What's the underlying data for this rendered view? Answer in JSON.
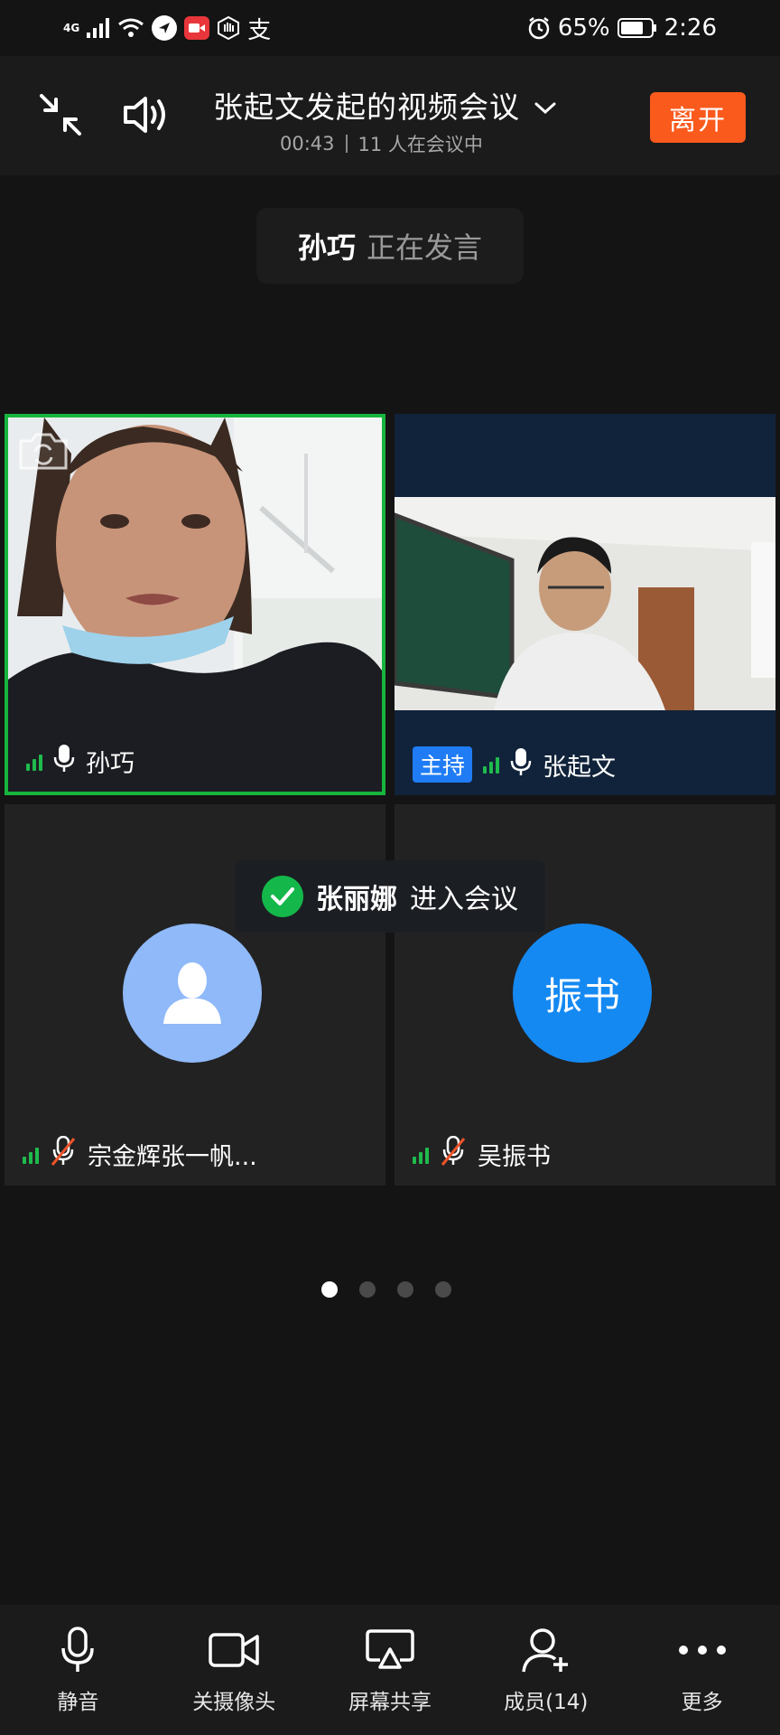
{
  "status_bar": {
    "network": "4G",
    "alipay_glyph": "支",
    "battery": "65%",
    "time": "2:26"
  },
  "header": {
    "title": "张起文发起的视频会议",
    "duration": "00:43",
    "participants_text": "11 人在会议中",
    "leave_label": "离开"
  },
  "speaking": {
    "name": "孙巧",
    "status": "正在发言"
  },
  "tiles": [
    {
      "name": "孙巧",
      "mic": "on",
      "active_speaker": true
    },
    {
      "name": "张起文",
      "host_label": "主持",
      "mic": "on"
    },
    {
      "name": "宗金辉张一帆...",
      "mic": "muted",
      "avatar": "person-icon"
    },
    {
      "name": "吴振书",
      "mic": "muted",
      "avatar_text": "振书"
    }
  ],
  "toast": {
    "name": "张丽娜",
    "message": "进入会议"
  },
  "pagination": {
    "pages": 4,
    "current": 1
  },
  "toolbar": {
    "mute": "静音",
    "camera_off": "关摄像头",
    "screen_share": "屏幕共享",
    "members": "成员(14)",
    "more": "更多"
  },
  "colors": {
    "background": "#141414",
    "leave": "#fb5a1d",
    "active_border": "#16b53d",
    "host_badge": "#1f7cf5",
    "signal": "#1fbb4d"
  }
}
